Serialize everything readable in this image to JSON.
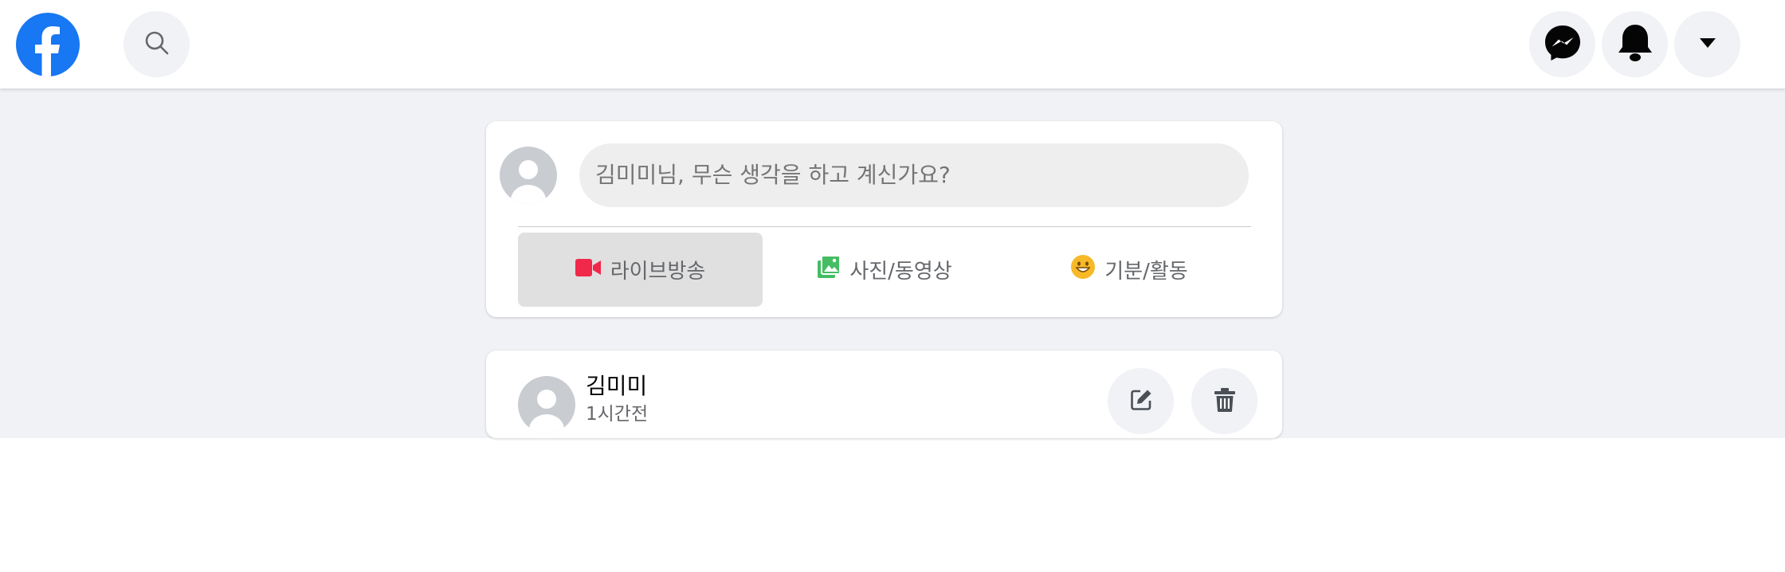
{
  "header": {
    "logo_icon": "facebook-logo",
    "search_icon": "search-icon",
    "right_icons": [
      "messenger-icon",
      "bell-icon",
      "caret-down-icon"
    ]
  },
  "composer": {
    "placeholder": "김미미님, 무슨 생각을 하고 계신가요?",
    "actions": [
      {
        "label": "라이브방송",
        "icon": "video-camera-icon",
        "color": "#f02849"
      },
      {
        "label": "사진/동영상",
        "icon": "photo-icon",
        "color": "#45bd62"
      },
      {
        "label": "기분/활동",
        "icon": "smiley-icon",
        "color": "#f7b928"
      }
    ]
  },
  "post": {
    "author": "김미미",
    "time": "1시간전",
    "tools": [
      "edit-icon",
      "trash-icon"
    ]
  },
  "colors": {
    "brand": "#1877f2",
    "background": "#f0f2f5",
    "active_action": "#e0e0e0"
  }
}
